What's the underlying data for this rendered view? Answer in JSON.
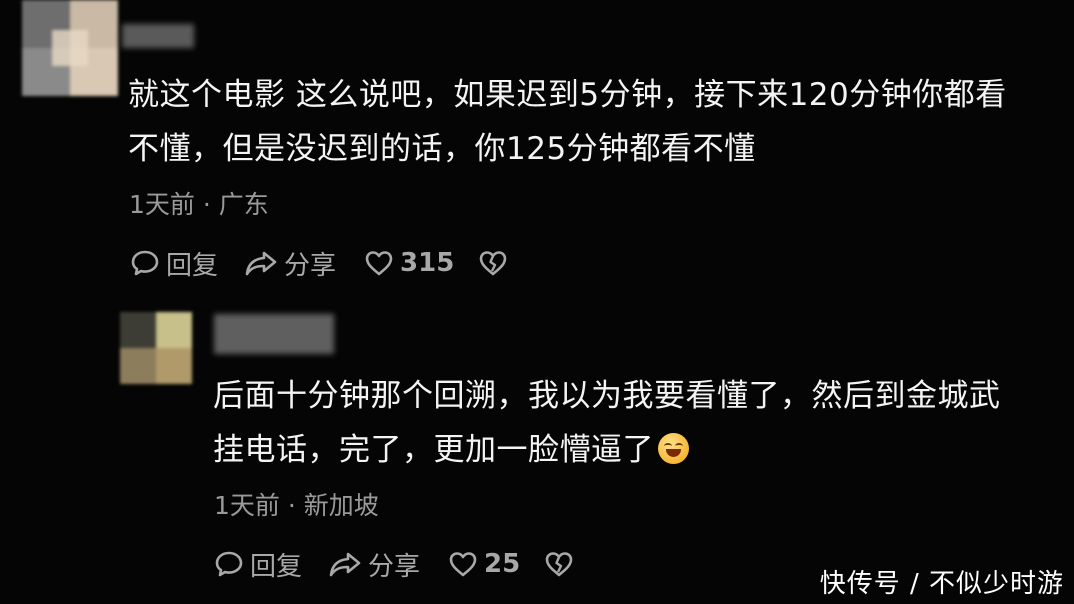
{
  "comments": [
    {
      "text_line1": "就这个电影 这么说吧，如果迟到5分钟，接下来120分钟你都看",
      "text_line2": "不懂，但是没迟到的话，你125分钟都看不懂",
      "meta": "1天前 · 广东",
      "reply_label": "回复",
      "share_label": "分享",
      "likes": "315"
    },
    {
      "text_line1": "后面十分钟那个回溯，我以为我要看懂了，然后到金城武",
      "text_line2": "挂电话，完了，更加一脸懵逼了",
      "meta": "1天前 · 新加坡",
      "reply_label": "回复",
      "share_label": "分享",
      "likes": "25"
    }
  ],
  "watermark": "快传号 / 不似少时游",
  "colors": {
    "background": "#050505",
    "text": "#f4f4f4",
    "meta": "#9a9a9a"
  },
  "icons": [
    "comment-bubble-icon",
    "share-arrow-icon",
    "heart-icon",
    "broken-heart-icon",
    "grinning-emoji-icon"
  ]
}
